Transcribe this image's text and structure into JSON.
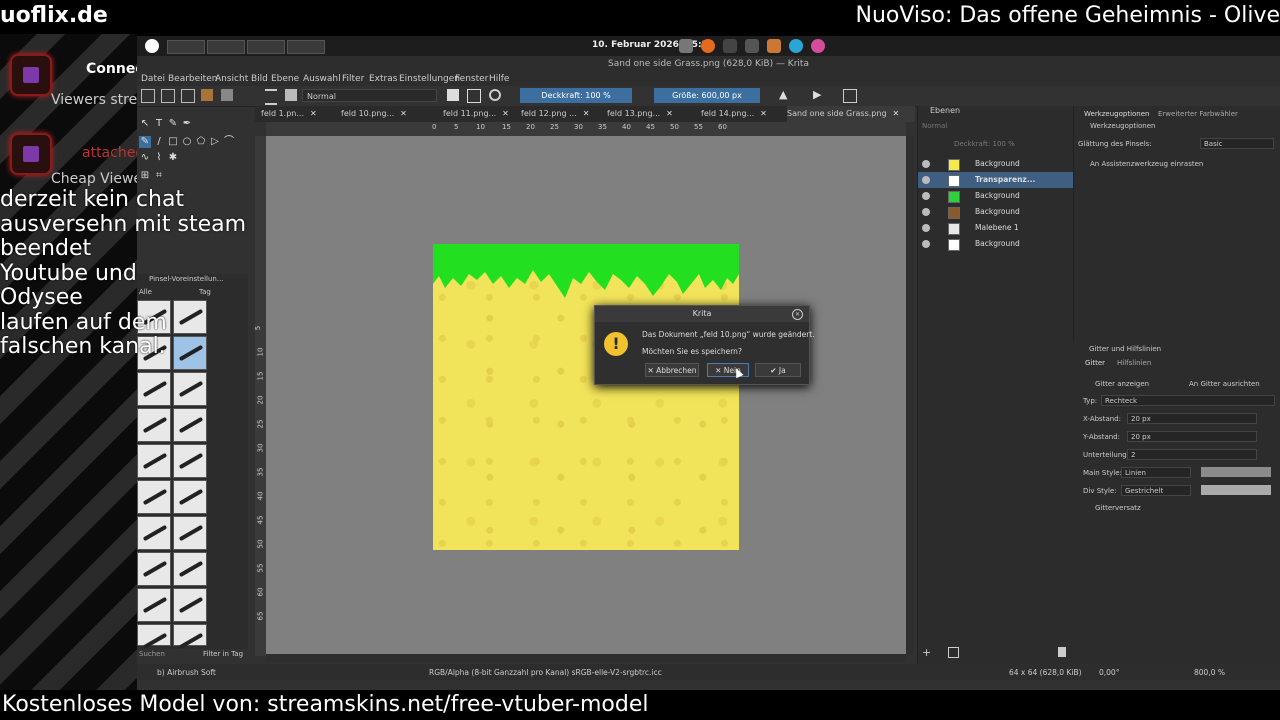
{
  "overlay": {
    "top_left": "uoflix.de",
    "top_right": "NuoViso: Das offene Geheimnis - Olive",
    "bottom_banner": "Kostenloses Model von: streamskins.net/free-vtuber-model",
    "widget1_a": "Connec",
    "widget1_b": "Viewers strea",
    "widget2_a": "attached",
    "widget2_b": "Cheap Viewer",
    "chat_note": [
      "derzeit kein chat",
      "ausversehn mit steam",
      "beendet",
      "Youtube und",
      "Odysee",
      "laufen auf dem",
      "falschen kanal."
    ]
  },
  "taskbar": {
    "date": "10. Februar 2026, 05:28"
  },
  "window": {
    "title": "Sand one side Grass.png (628,0 KiB) — Krita",
    "menu": [
      "Datei",
      "Bearbeiten",
      "Ansicht",
      "Bild",
      "Ebene",
      "Auswahl",
      "Filter",
      "Extras",
      "Einstellungen",
      "Fenster",
      "Hilfe"
    ]
  },
  "toolbar": {
    "blend_mode": "Normal",
    "opacity": "Deckkraft: 100 %",
    "size": "Größe: 600,00 px"
  },
  "tabs": [
    "feld 1.pn...",
    "feld 10.png...",
    "feld 11.png...",
    "feld 12.png ...",
    "feld 13.png...",
    "feld 14.png...",
    "Sand one side Grass.png"
  ],
  "ruler_h": [
    "0",
    "5",
    "10",
    "15",
    "20",
    "25",
    "30",
    "35",
    "40",
    "45",
    "50",
    "55",
    "60"
  ],
  "ruler_v": [
    "5",
    "10",
    "15",
    "20",
    "25",
    "30",
    "35",
    "40",
    "45",
    "50",
    "55",
    "60",
    "65"
  ],
  "brush_panel": {
    "title": "Pinsel-Voreinstellun...",
    "filter": "Alle",
    "tag": "Tag",
    "search": "Suchen",
    "filter_tag": "Filter in Tag"
  },
  "layers": {
    "title": "Ebenen",
    "mode": "Normal",
    "opacity": "Deckkraft: 100 %",
    "items": [
      {
        "name": "Background",
        "color": "#f5e94e"
      },
      {
        "name": "Transparenz...",
        "color": "#ffffff"
      },
      {
        "name": "Background",
        "color": "#2fd13a"
      },
      {
        "name": "Background",
        "color": "#8a5a2a"
      },
      {
        "name": "Malebene 1",
        "color": "#e8e8e8"
      },
      {
        "name": "Background",
        "color": "#ffffff"
      }
    ]
  },
  "tool_options": {
    "tab1": "Werkzeugoptionen",
    "tab2": "Erweiterter Farbwähler",
    "header": "Werkzeugoptionen",
    "smoothing_label": "Glättung des Pinsels:",
    "smoothing_value": "Basic",
    "snap_assistant": "An Assistenzwerkzeug einrasten"
  },
  "grid": {
    "title": "Gitter und Hilfslinien",
    "tab1": "Gitter",
    "tab2": "Hilfslinien",
    "show_grid": "Gitter anzeigen",
    "snap_grid": "An Gitter ausrichten",
    "type_label": "Typ:",
    "type_value": "Rechteck",
    "x_label": "X-Abstand:",
    "x_value": "20 px",
    "y_label": "Y-Abstand:",
    "y_value": "20 px",
    "sub_label": "Unterteilung:",
    "sub_value": "2",
    "main_style_label": "Main Style:",
    "main_style_value": "Linien",
    "div_style_label": "Div Style:",
    "div_style_value": "Gestrichelt",
    "offset": "Gitterversatz"
  },
  "status": {
    "brush": "b) Airbrush Soft",
    "color_space": "RGB/Alpha (8-bit Ganzzahl pro Kanal)  sRGB-elle-V2-srgbtrc.icc",
    "image_size": "64 x 64 (628,0 KiB)",
    "rotation": "0,00°",
    "zoom": "800,0 %"
  },
  "dialog": {
    "title": "Krita",
    "line1": "Das Dokument „feld 10.png“ wurde geändert.",
    "line2": "Möchten Sie es speichern?",
    "cancel": "Abbrechen",
    "no": "Nein",
    "yes": "Ja"
  }
}
